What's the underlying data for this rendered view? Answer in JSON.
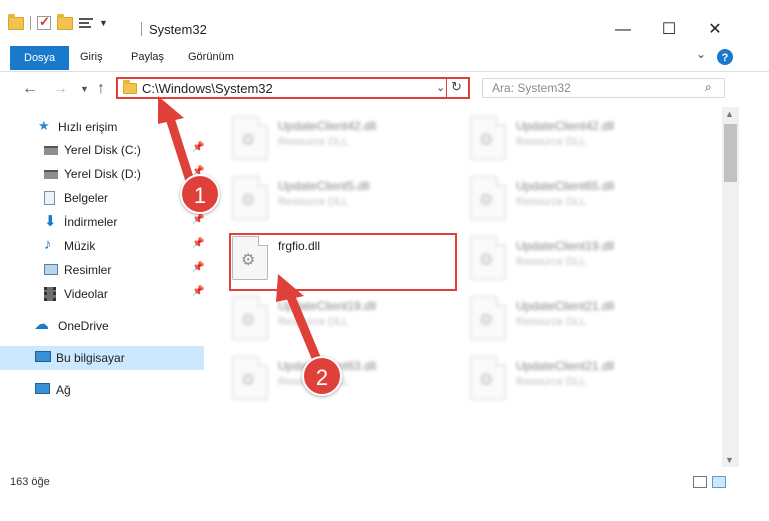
{
  "window": {
    "title": "System32",
    "minimize_glyph": "—",
    "maximize_glyph": "☐",
    "close_glyph": "✕"
  },
  "ribbon": {
    "tabs": [
      "Dosya",
      "Giriş",
      "Paylaş",
      "Görünüm"
    ],
    "accent_color": "#1979ca"
  },
  "address_bar": {
    "path": "C:\\Windows\\System32"
  },
  "search": {
    "placeholder": "Ara: System32"
  },
  "sidebar": {
    "quick_access_label": "Hızlı erişim",
    "items": [
      {
        "label": "Yerel Disk (C:)",
        "icon": "drive-icon",
        "pinned": true
      },
      {
        "label": "Yerel Disk (D:)",
        "icon": "drive-icon",
        "pinned": true
      },
      {
        "label": "Belgeler",
        "icon": "documents-icon",
        "pinned": true
      },
      {
        "label": "İndirmeler",
        "icon": "downloads-icon",
        "pinned": true
      },
      {
        "label": "Müzik",
        "icon": "music-icon",
        "pinned": true
      },
      {
        "label": "Resimler",
        "icon": "pictures-icon",
        "pinned": true
      },
      {
        "label": "Videolar",
        "icon": "videos-icon",
        "pinned": true
      }
    ],
    "onedrive_label": "OneDrive",
    "this_pc_label": "Bu bilgisayar",
    "network_label": "Ağ"
  },
  "files": {
    "left_column": [
      {
        "name": "UpdateClient42.dll",
        "type": "Resource DLL",
        "blurred": true
      },
      {
        "name": "UpdateClient5.dll",
        "type": "Resource DLL",
        "blurred": true
      },
      {
        "name": "frgfio.dll",
        "type": "",
        "blurred": false
      },
      {
        "name": "UpdateClient19.dll",
        "type": "Resource DLL",
        "blurred": true
      },
      {
        "name": "UpdateClient63.dll",
        "type": "Resource DLL",
        "blurred": true
      }
    ],
    "right_column": [
      {
        "name": "UpdateClient42.dll",
        "type": "Resource DLL",
        "blurred": true
      },
      {
        "name": "UpdateClient65.dll",
        "type": "Resource DLL",
        "blurred": true
      },
      {
        "name": "UpdateClient19.dll",
        "type": "Resource DLL",
        "blurred": true
      },
      {
        "name": "UpdateClient21.dll",
        "type": "Resource DLL",
        "blurred": true
      },
      {
        "name": "UpdateClient21.dll",
        "type": "Resource DLL",
        "blurred": true
      }
    ]
  },
  "status": {
    "item_count": "163 öğe"
  },
  "annotations": {
    "step1": "1",
    "step2": "2",
    "color": "#e0403a"
  }
}
